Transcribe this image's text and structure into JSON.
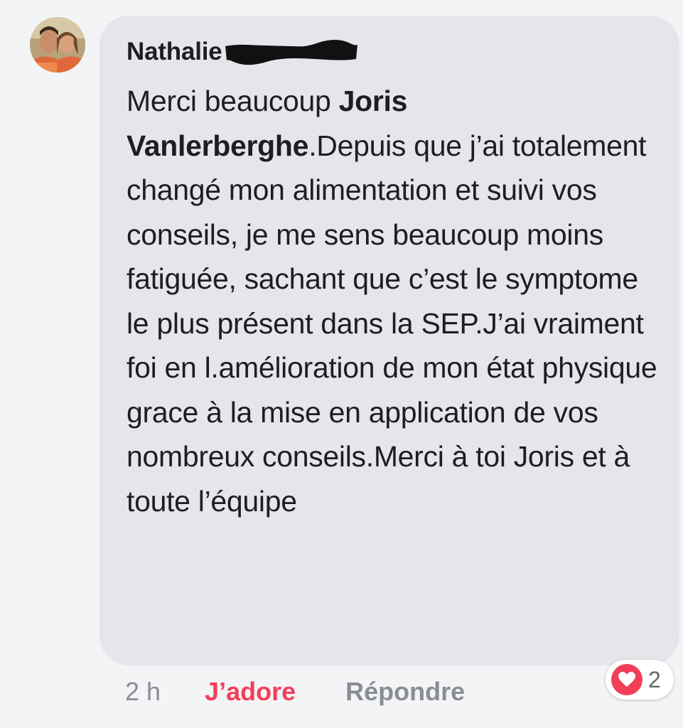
{
  "comment": {
    "author": "Nathalie",
    "text_before_mention": "Merci beaucoup ",
    "mention": "Joris Vanlerberghe",
    "text_after_mention": ".Depuis que j’ai totalement changé mon alimentation et suivi vos conseils, je me sens beaucoup moins fatiguée, sachant que c’est le symptome le plus présent dans la SEP.J’ai vraiment foi en l.amélioration de mon état physique grace à la mise en application de vos nombreux conseils.Merci à toi Joris et à toute l’équipe"
  },
  "meta": {
    "timestamp": "2 h",
    "love_label": "J’adore",
    "reply_label": "Répondre"
  },
  "reactions": {
    "icon": "heart-icon",
    "count": "2",
    "color": "#f33e58"
  }
}
